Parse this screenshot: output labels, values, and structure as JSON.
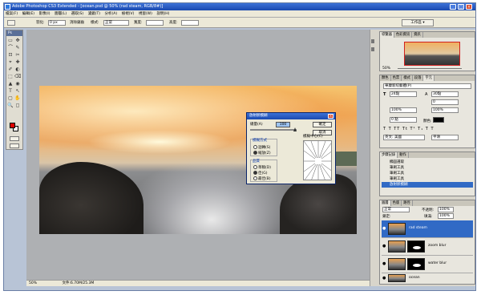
{
  "window": {
    "title": "Adobe Photoshop CS3 Extended - [ocean.psd @ 50% (rad steam, RGB/8#)]",
    "controls": [
      "_",
      "□",
      "×"
    ]
  },
  "menubar": {
    "items": [
      "檔案(F)",
      "編輯(E)",
      "影像(I)",
      "圖層(L)",
      "選取(S)",
      "濾鏡(T)",
      "分析(A)",
      "檢視(V)",
      "視窗(W)",
      "說明(H)"
    ]
  },
  "options": {
    "feather_label": "羽化:",
    "feather_value": "0 px",
    "antialias_label": "消除鋸齒",
    "style_label": "樣式:",
    "style_value": "正常",
    "width_label": "寬度:",
    "height_label": "高度:",
    "workspace_label": "工作區 ▾"
  },
  "toolbox": {
    "label": "Ps",
    "tools": [
      "▭",
      "✥",
      "⌒",
      "✎",
      "⊡",
      "✂",
      "⌖",
      "✚",
      "✐",
      "◐",
      "⬚",
      "⌫",
      "▲",
      "◉",
      "T",
      "↖",
      "▢",
      "✋",
      "🔍",
      "◻"
    ]
  },
  "statusbar": {
    "zoom": "50%",
    "doc": "文件:6.70M/25.3M"
  },
  "dialog": {
    "title": "放射狀模糊",
    "amount_label": "總量(A)",
    "amount_value": "100",
    "ok": "確定",
    "cancel": "取消",
    "method_label": "模糊方式",
    "method_options": [
      "迴轉(S)",
      "縮放(Z)"
    ],
    "method_selected": 1,
    "quality_label": "品質",
    "quality_options": [
      "草稿(D)",
      "佳(G)",
      "最佳(B)"
    ],
    "quality_selected": 1,
    "center_label": "模糊中心(C)"
  },
  "navigator": {
    "tabs": [
      "導覽器",
      "色彩資訊",
      "資訊"
    ],
    "zoom": "50%"
  },
  "character": {
    "tabs": [
      "顏色",
      "色票",
      "樣式",
      "段落",
      "字元"
    ],
    "font": "華康新綜藝體(P)",
    "size": "24點",
    "leading": "30點",
    "tracking": "0",
    "scale_v": "100%",
    "scale_h": "100%",
    "baseline": "0 點",
    "color_label": "顏色:",
    "lang": "英文: 美國",
    "aa": "平滑"
  },
  "history": {
    "tabs": [
      "步驟記錄",
      "動作"
    ],
    "items": [
      "橢圓選取",
      "筆刷工具",
      "筆刷工具",
      "筆刷工具",
      "放射狀模糊"
    ],
    "selected": 4
  },
  "layers": {
    "tabs": [
      "圖層",
      "色版",
      "路徑"
    ],
    "blend": "正常",
    "opacity_label": "不透明:",
    "opacity": "100%",
    "lock_label": "鎖定:",
    "fill_label": "填滿:",
    "fill": "100%",
    "rows": [
      {
        "name": "rad steam",
        "selected": true
      },
      {
        "name": "zoom blur",
        "selected": false
      },
      {
        "name": "water blur",
        "selected": false
      },
      {
        "name": "ocean",
        "selected": false
      }
    ]
  }
}
